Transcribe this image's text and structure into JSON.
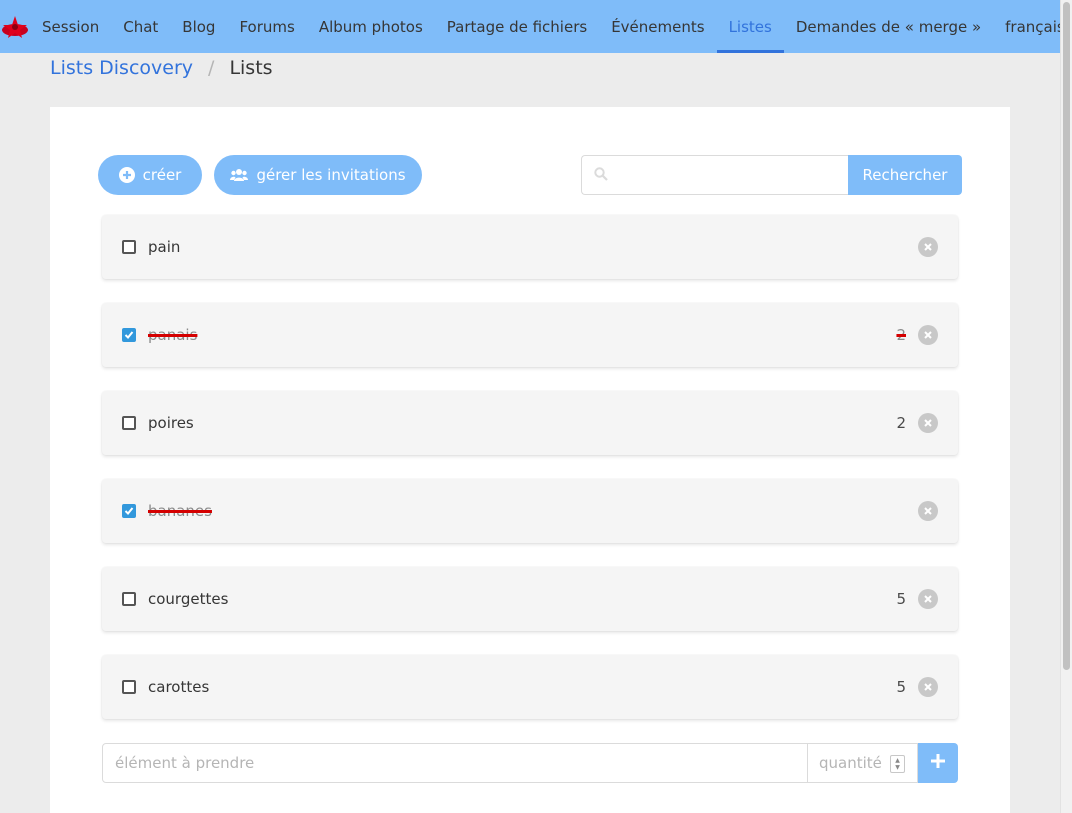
{
  "nav": {
    "items": [
      {
        "label": "Session",
        "active": false
      },
      {
        "label": "Chat",
        "active": false
      },
      {
        "label": "Blog",
        "active": false
      },
      {
        "label": "Forums",
        "active": false
      },
      {
        "label": "Album photos",
        "active": false
      },
      {
        "label": "Partage de fichiers",
        "active": false
      },
      {
        "label": "Événements",
        "active": false
      },
      {
        "label": "Listes",
        "active": true
      },
      {
        "label": "Demandes de « merge »",
        "active": false
      }
    ],
    "language": "français"
  },
  "breadcrumb": {
    "parent": "Lists Discovery",
    "separator": "/",
    "current": "Lists"
  },
  "toolbar": {
    "create_label": "créer",
    "invitations_label": "gérer les invitations",
    "search_value": "",
    "search_button": "Rechercher"
  },
  "items": [
    {
      "label": "pain",
      "qty": "",
      "checked": false
    },
    {
      "label": "panais",
      "qty": "2",
      "checked": true
    },
    {
      "label": "poires",
      "qty": "2",
      "checked": false
    },
    {
      "label": "bananes",
      "qty": "",
      "checked": true
    },
    {
      "label": "courgettes",
      "qty": "5",
      "checked": false
    },
    {
      "label": "carottes",
      "qty": "5",
      "checked": false
    }
  ],
  "add_form": {
    "name_placeholder": "élément à prendre",
    "qty_placeholder": "quantité"
  },
  "colors": {
    "accent": "#7fbcf9",
    "link": "#3273dc",
    "checkbox": "#3298dc",
    "strike": "#d40000"
  },
  "icons": {
    "logo": "red-star-logo-icon",
    "create": "plus-circle-icon",
    "invitations": "users-icon",
    "search": "search-icon",
    "delete": "close-circle-icon",
    "add": "plus-icon",
    "language": "chevron-down-icon"
  }
}
